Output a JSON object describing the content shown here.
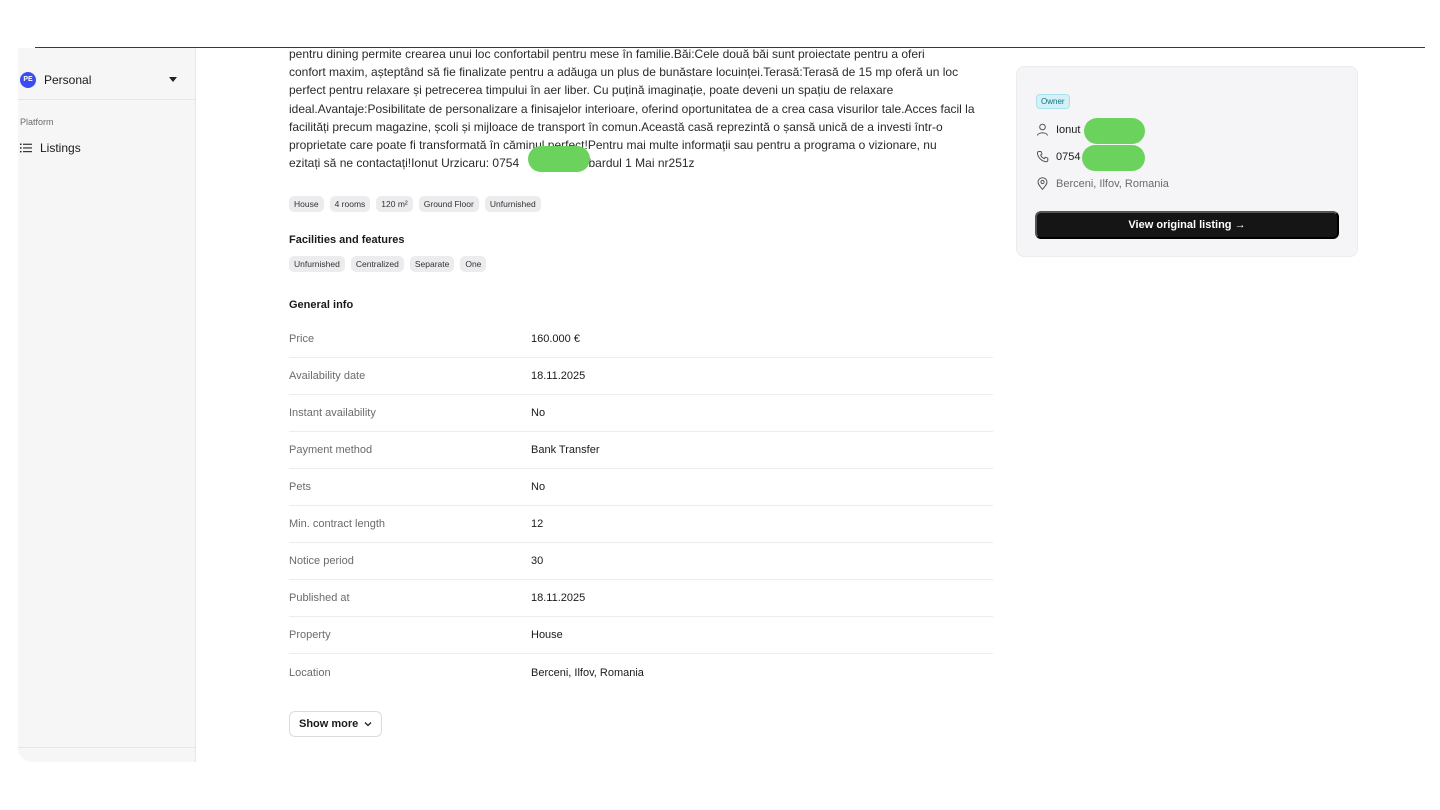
{
  "sidebar": {
    "workspace": {
      "avatar_initials": "PE",
      "name": "Personal"
    },
    "section_label": "Platform",
    "items": [
      {
        "label": "Listings",
        "icon": "list-icon"
      }
    ]
  },
  "listing": {
    "description": {
      "line1": "pentru dining permite crearea unui loc confortabil pentru mese în familie.Băi:Cele două băi sunt proiectate pentru a oferi",
      "line2": "confort maxim, așteptând să fie finalizate pentru a adăuga un plus de bunăstare locuinței.Terasă:Terasă de 15 mp oferă un loc",
      "line3": "perfect pentru relaxare și petrecerea timpului în aer liber. Cu puțină imaginație, poate deveni un spațiu de relaxare",
      "line4": "ideal.Avantaje:Posibilitate de personalizare a finisajelor interioare, oferind oportunitatea de a crea casa visurilor tale.Acces facil la",
      "line5": "facilități precum magazine, școli și mijloace de transport în comun.Această casă reprezintă o șansă unică de a investi într-o",
      "line6": "proprietate care poate fi transformată în căminul perfect!Pentru mai multe informații sau pentru a programa o vizionare, nu",
      "line7a": "ezitați să ne contactați!Ionut Urzicaru: 0754",
      "line7b": "lebardul 1 Mai nr251z"
    },
    "tags": [
      "House",
      "4 rooms",
      "120 m²",
      "Ground Floor",
      "Unfurnished"
    ],
    "facilities_title": "Facilities and features",
    "facilities": [
      "Unfurnished",
      "Centralized",
      "Separate",
      "One"
    ],
    "general_title": "General info",
    "general_info": [
      {
        "key": "Price",
        "value": "160.000 €"
      },
      {
        "key": "Availability date",
        "value": "18.11.2025"
      },
      {
        "key": "Instant availability",
        "value": "No"
      },
      {
        "key": "Payment method",
        "value": "Bank Transfer"
      },
      {
        "key": "Pets",
        "value": "No"
      },
      {
        "key": "Min. contract length",
        "value": "12"
      },
      {
        "key": "Notice period",
        "value": "30"
      },
      {
        "key": "Published at",
        "value": "18.11.2025"
      },
      {
        "key": "Property",
        "value": "House"
      },
      {
        "key": "Location",
        "value": "Berceni, Ilfov, Romania"
      }
    ],
    "show_more_label": "Show more"
  },
  "contact_card": {
    "badge": "Owner",
    "name": "Ionut",
    "phone": "0754",
    "location": "Berceni, Ilfov, Romania",
    "button_label": "View original listing →"
  },
  "colors": {
    "accent": "#3b4cf0",
    "redaction": "#6bd35d",
    "button_bg": "#151515",
    "badge_bg": "#d4f1f6"
  }
}
